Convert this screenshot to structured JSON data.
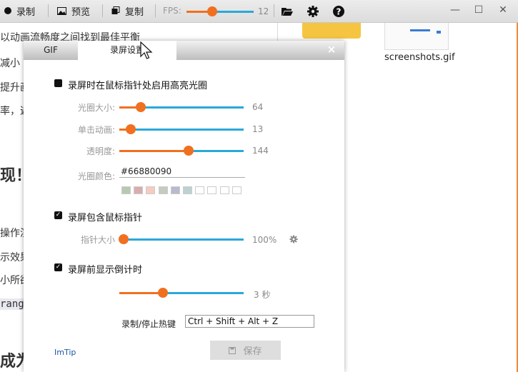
{
  "toolbar": {
    "record_label": "录制",
    "preview_label": "预览",
    "copy_label": "复制",
    "fps_label": "FPS:",
    "fps_value": "12",
    "fps_fraction": 0.38
  },
  "background": {
    "left_lines": [
      "以动画流畅度之间找到最佳平衡",
      "减小",
      "提升画",
      "率，遮",
      "现！",
      "操作演",
      "示效果",
      "小所欲",
      "rangi",
      "成为"
    ],
    "file_name": "screenshots.gif"
  },
  "dialog": {
    "tabs": [
      "GIF",
      "录屏设置"
    ],
    "close": "×",
    "highlight": {
      "label": "录屏时在鼠标指针处启用高亮光圈",
      "checked": false,
      "size_label": "光圈大小:",
      "size_value": "64",
      "size_fraction": 0.17,
      "click_label": "单击动画:",
      "click_value": "13",
      "click_fraction": 0.09,
      "opacity_label": "透明度:",
      "opacity_value": "144",
      "opacity_fraction": 0.56,
      "color_label": "光圈颜色:",
      "color_value": "#66880090",
      "swatches": [
        "#b8c8b4",
        "#d9adae",
        "#f7cbbf",
        "#c4ccc0",
        "#b9b9d0",
        "#bcd2d2",
        "#ffffff",
        "#ffffff",
        "#ffffff",
        "#ffffff"
      ]
    },
    "include_cursor": {
      "label": "录屏包含鼠标指针",
      "checked": true,
      "pointer_size_label": "指针大小",
      "pointer_size_value": "100%",
      "pointer_fraction": 0.0
    },
    "countdown": {
      "label": "录屏前显示倒计时",
      "checked": true,
      "value": "3 秒",
      "fraction": 0.35
    },
    "hotkey": {
      "label": "录制/停止热键",
      "value": "Ctrl + Shift + Alt + Z"
    },
    "imtip": "ImTip",
    "save_label": "保存"
  },
  "colors": {
    "accent": "#f07020",
    "slider_track": "#2aa8d8",
    "link": "#1a55a8"
  }
}
